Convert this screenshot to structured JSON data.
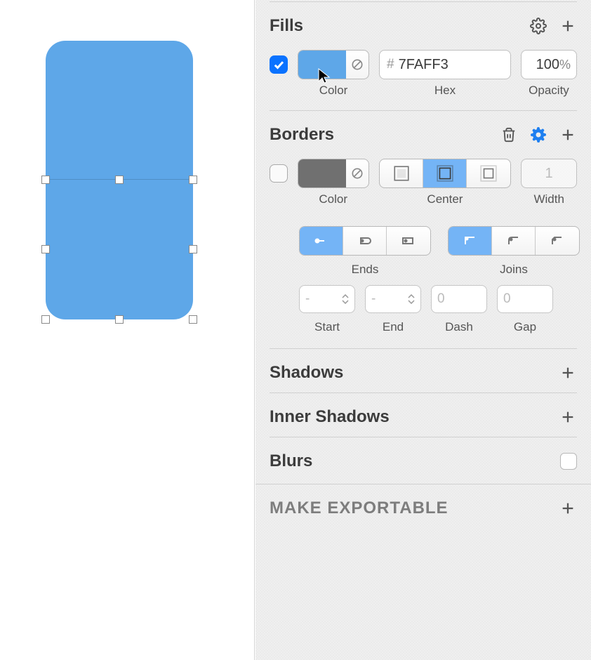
{
  "fills": {
    "title": "Fills",
    "enabled": true,
    "hex": "7FAFF3",
    "opacity": "100",
    "color_label": "Color",
    "hex_label": "Hex",
    "opacity_label": "Opacity",
    "swatch_color": "#5ea7e8"
  },
  "borders": {
    "title": "Borders",
    "enabled": false,
    "color_label": "Color",
    "position_label": "Center",
    "width_label": "Width",
    "width_placeholder": "1",
    "swatch_color": "#707070",
    "ends_label": "Ends",
    "joins_label": "Joins",
    "start_label": "Start",
    "start_placeholder": "-",
    "end_label": "End",
    "end_placeholder": "-",
    "dash_label": "Dash",
    "dash_placeholder": "0",
    "gap_label": "Gap",
    "gap_placeholder": "0"
  },
  "shadows": {
    "title": "Shadows"
  },
  "inner_shadows": {
    "title": "Inner Shadows"
  },
  "blurs": {
    "title": "Blurs"
  },
  "exportable": {
    "title": "MAKE EXPORTABLE"
  },
  "shape": {
    "fill": "#5ea7e8",
    "radius": 28
  }
}
